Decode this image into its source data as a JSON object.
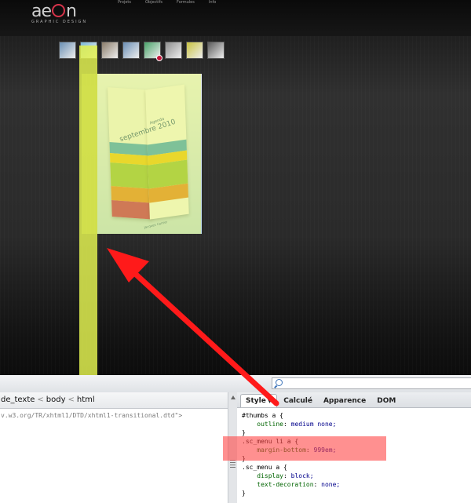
{
  "site": {
    "logo_prefix": "ae",
    "logo_suffix": "n",
    "logo_sub": "GRAPHIC DESIGN",
    "nav": [
      "Projets",
      "Objectifs",
      "Formules",
      "Info"
    ],
    "brochure_sub": "Agenda",
    "brochure_title": "septembre 2010",
    "brochure_footer": "Jacques Cartier",
    "colors": {
      "highlight_yellow": "#e0f050",
      "highlight_red": "#ff4646",
      "arrow": "#ff1a1a"
    }
  },
  "thumbnails": [
    {
      "name": "thumb-1",
      "color": "#6a8fb3"
    },
    {
      "name": "thumb-2",
      "color": "#7bb8d8"
    },
    {
      "name": "thumb-3",
      "color": "#8a7c6a"
    },
    {
      "name": "thumb-4",
      "color": "#6b8fb5"
    },
    {
      "name": "thumb-5",
      "color": "#4aa36a"
    },
    {
      "name": "thumb-6",
      "color": "#8e8e8e"
    },
    {
      "name": "thumb-7",
      "color": "#c9c341"
    },
    {
      "name": "thumb-8",
      "color": "#5a5a5a"
    }
  ],
  "devtools": {
    "breadcrumb": [
      "de_texte",
      "body",
      "html"
    ],
    "doctype_line": "v.w3.org/TR/xhtml1/DTD/xhtml1-transitional.dtd\">",
    "tabs": [
      {
        "label": "Style",
        "active": true
      },
      {
        "label": "Calculé",
        "active": false
      },
      {
        "label": "Apparence",
        "active": false
      },
      {
        "label": "DOM",
        "active": false
      }
    ],
    "css_rules": [
      {
        "selector": "#thumbs a {",
        "decls": [
          {
            "prop": "outline",
            "val": "medium none;"
          }
        ],
        "close": "}"
      },
      {
        "selector": ".sc_menu li a {",
        "decls": [
          {
            "prop": "margin-bottom",
            "val": "999em;"
          }
        ],
        "close": "}"
      },
      {
        "selector": ".sc_menu a {",
        "decls": [
          {
            "prop": "display",
            "val": "block;"
          },
          {
            "prop": "text-decoration",
            "val": "none;"
          }
        ],
        "close": "}"
      }
    ]
  }
}
